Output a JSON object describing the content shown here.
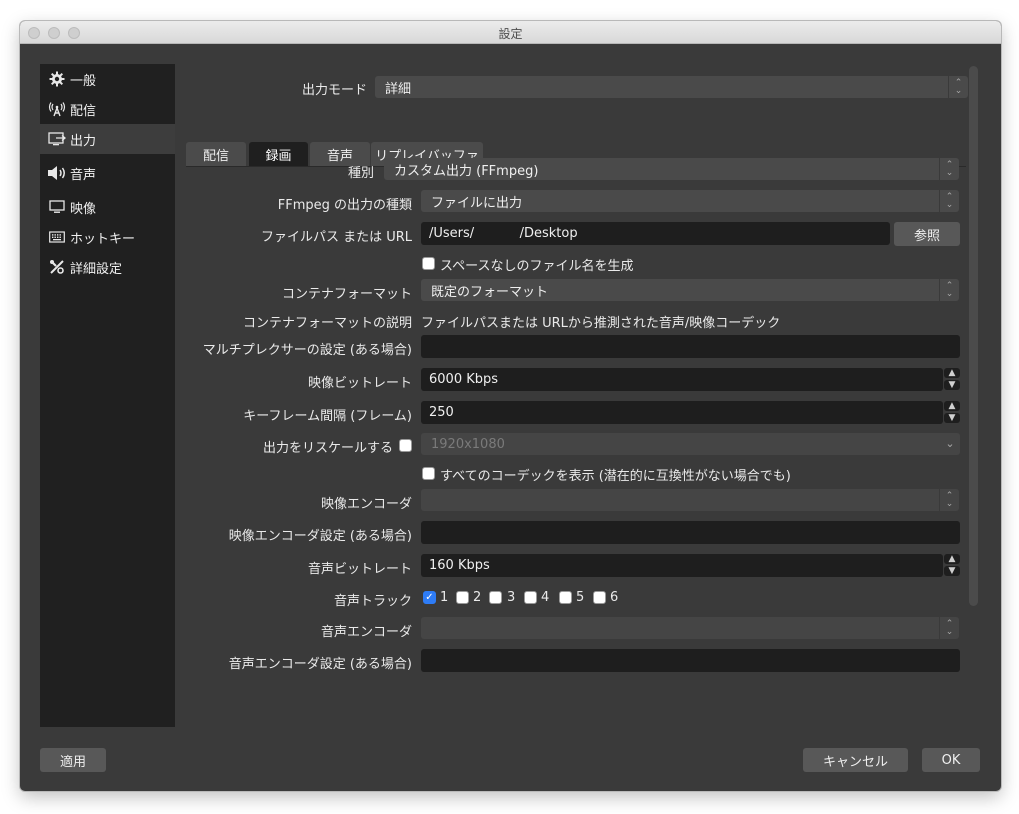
{
  "window": {
    "title": "設定"
  },
  "sidebar": {
    "items": [
      {
        "label": "一般",
        "icon": "gear-icon"
      },
      {
        "label": "配信",
        "icon": "broadcast-icon"
      },
      {
        "label": "出力",
        "icon": "output-icon",
        "active": true
      },
      {
        "label": "音声",
        "icon": "speaker-icon"
      },
      {
        "label": "映像",
        "icon": "monitor-icon"
      },
      {
        "label": "ホットキー",
        "icon": "keyboard-icon"
      },
      {
        "label": "詳細設定",
        "icon": "tools-icon"
      }
    ]
  },
  "output_mode": {
    "label": "出力モード",
    "value": "詳細"
  },
  "tabs": [
    {
      "label": "配信"
    },
    {
      "label": "録画",
      "active": true
    },
    {
      "label": "音声"
    },
    {
      "label": "リプレイバッファ"
    }
  ],
  "recording": {
    "type": {
      "label": "種別",
      "value": "カスタム出力 (FFmpeg)"
    },
    "ffmpeg_output_type": {
      "label": "FFmpeg の出力の種類",
      "value": "ファイルに出力"
    },
    "file_path": {
      "label": "ファイルパス または URL",
      "value": "/Users/           /Desktop",
      "browse": "参照"
    },
    "no_space": {
      "label": "スペースなしのファイル名を生成",
      "checked": false
    },
    "container_format": {
      "label": "コンテナフォーマット",
      "value": "既定のフォーマット"
    },
    "container_desc": {
      "label": "コンテナフォーマットの説明",
      "value": "ファイルパスまたは URLから推測された音声/映像コーデック"
    },
    "muxer_settings": {
      "label": "マルチプレクサーの設定 (ある場合)",
      "value": ""
    },
    "video_bitrate": {
      "label": "映像ビットレート",
      "value": "6000 Kbps"
    },
    "keyframe_interval": {
      "label": "キーフレーム間隔 (フレーム)",
      "value": "250"
    },
    "rescale": {
      "label": "出力をリスケールする",
      "checked": false,
      "value": "1920x1080"
    },
    "show_all_codecs": {
      "label": "すべてのコーデックを表示 (潜在的に互換性がない場合でも)",
      "checked": false
    },
    "video_encoder": {
      "label": "映像エンコーダ",
      "value": ""
    },
    "video_encoder_settings": {
      "label": "映像エンコーダ設定 (ある場合)",
      "value": ""
    },
    "audio_bitrate": {
      "label": "音声ビットレート",
      "value": "160 Kbps"
    },
    "audio_track": {
      "label": "音声トラック",
      "tracks": [
        {
          "label": "1",
          "checked": true
        },
        {
          "label": "2",
          "checked": false
        },
        {
          "label": "3",
          "checked": false
        },
        {
          "label": "4",
          "checked": false
        },
        {
          "label": "5",
          "checked": false
        },
        {
          "label": "6",
          "checked": false
        }
      ]
    },
    "audio_encoder": {
      "label": "音声エンコーダ",
      "value": ""
    },
    "audio_encoder_settings": {
      "label": "音声エンコーダ設定 (ある場合)",
      "value": ""
    }
  },
  "footer": {
    "apply": "適用",
    "cancel": "キャンセル",
    "ok": "OK"
  }
}
